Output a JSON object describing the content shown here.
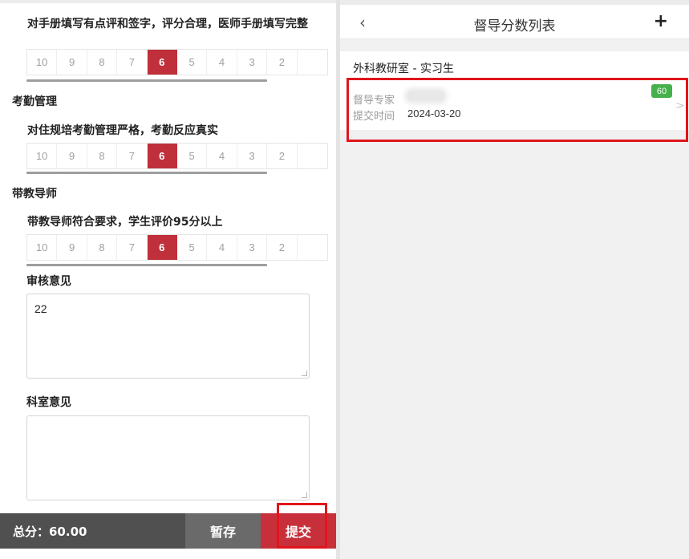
{
  "left": {
    "q1_label": "对手册填写有点评和签字，评分合理，医师手册填写完整",
    "section2_label": "考勤管理",
    "q2_label": "对住规培考勤管理严格，考勤反应真实",
    "section3_label": "带教导师",
    "q3_label": "带教导师符合要求，学生评价95分以上",
    "score_options": [
      "10",
      "9",
      "8",
      "7",
      "6",
      "5",
      "4",
      "3",
      "2",
      ""
    ],
    "selected_score": "6",
    "review_label": "审核意见",
    "review_value": "22",
    "dept_label": "科室意见",
    "dept_value": "",
    "total_label": "总分：60.00",
    "save_label": "暂存",
    "submit_label": "提交"
  },
  "right": {
    "back_icon": "‹",
    "title": "督导分数列表",
    "add_icon": "+",
    "group_title": "外科教研室 - 实习生",
    "card": {
      "expert_key": "督导专家",
      "time_key": "提交时间",
      "time_value": "2024-03-20",
      "score_badge": "60"
    }
  },
  "colors": {
    "accent": "#c7303b",
    "highlight": "#e0151b",
    "badge": "#46b04a"
  }
}
